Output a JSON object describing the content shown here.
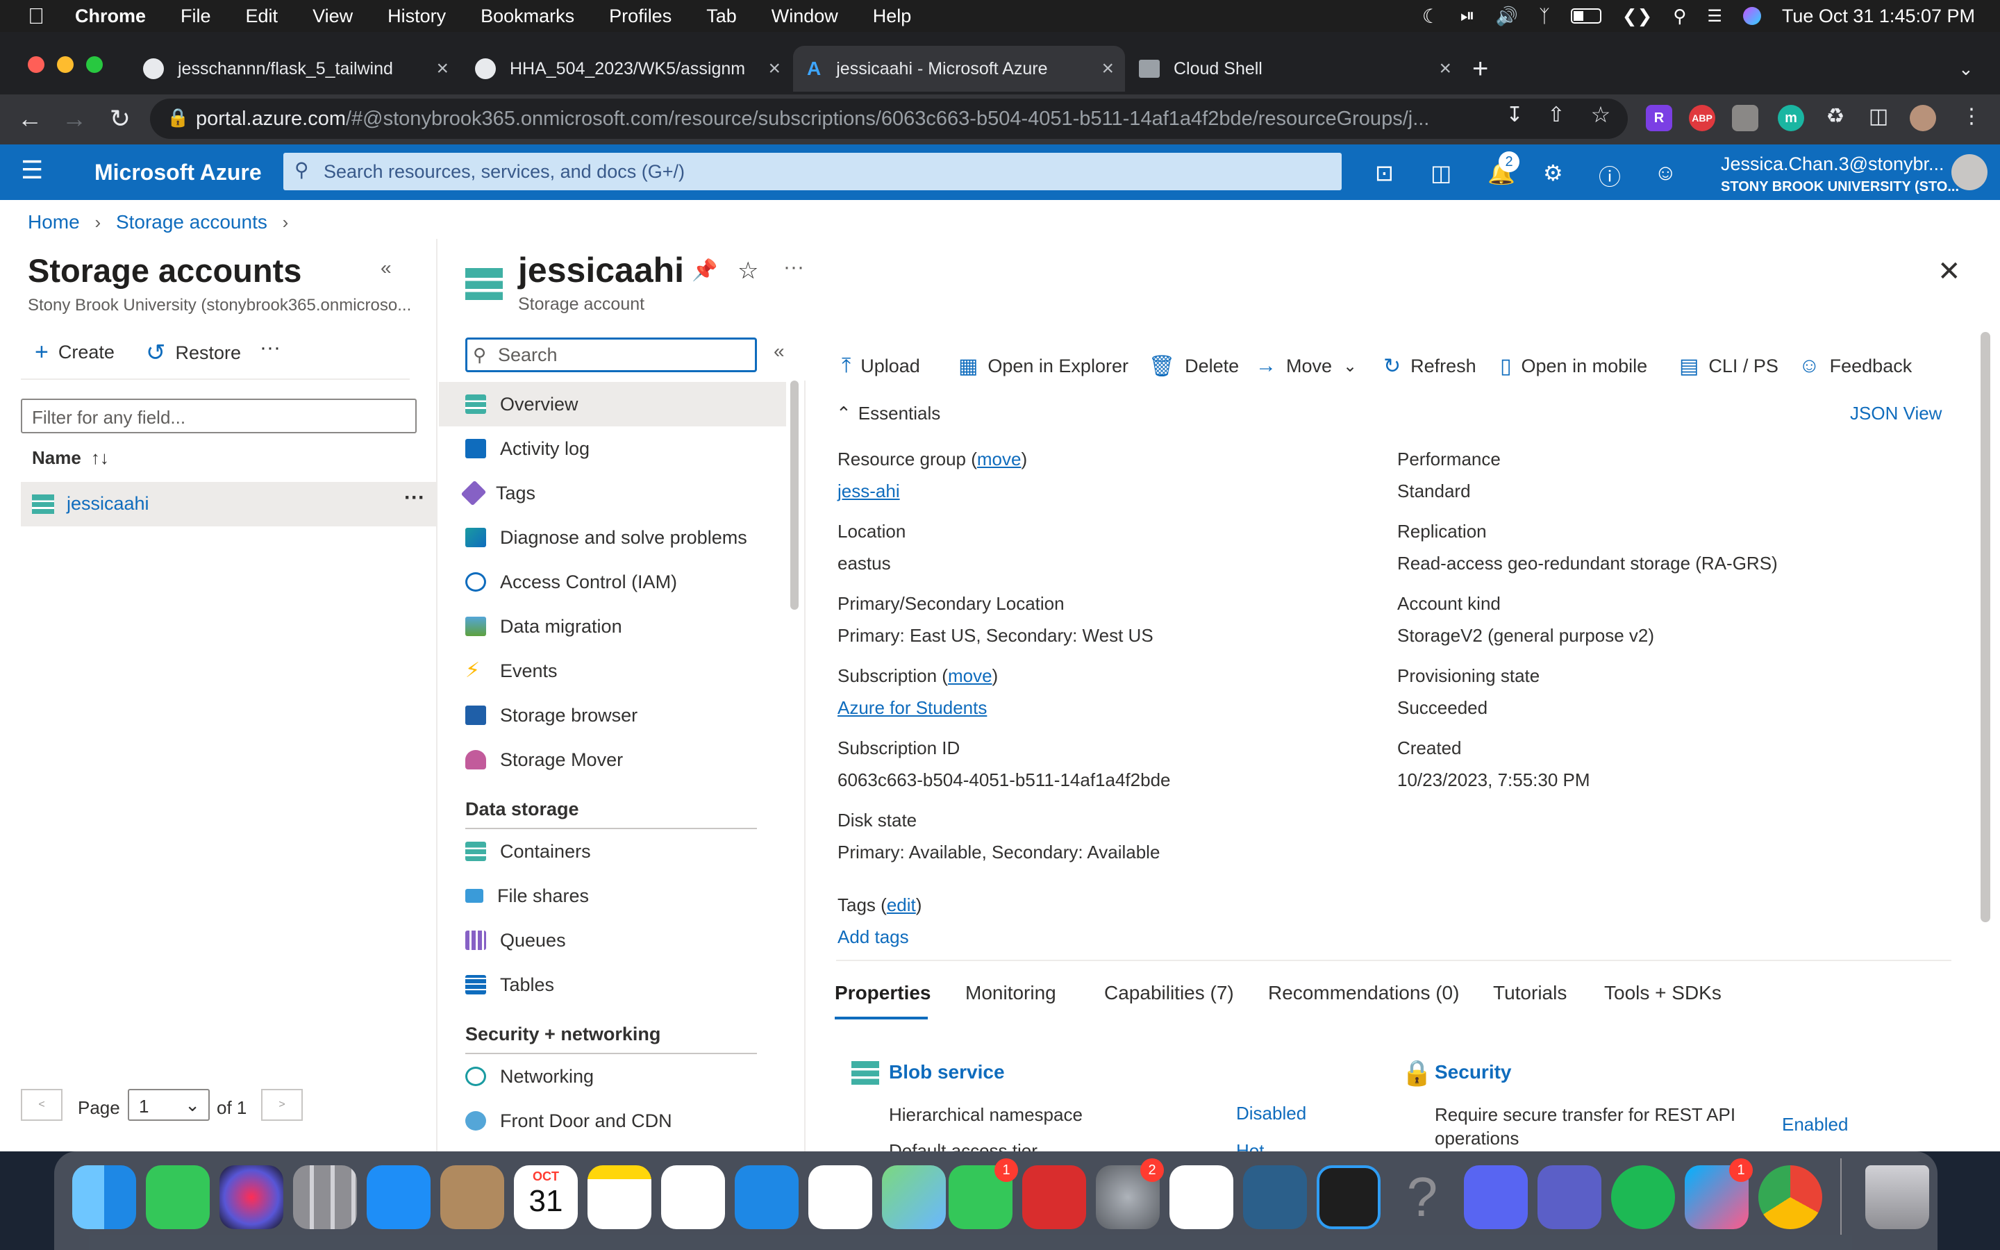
{
  "menubar": {
    "app": "Chrome",
    "items": [
      "File",
      "Edit",
      "View",
      "History",
      "Bookmarks",
      "Profiles",
      "Tab",
      "Window",
      "Help"
    ],
    "datetime": "Tue Oct 31  1:45:07 PM"
  },
  "browser": {
    "tabs": [
      {
        "title": "jesschannn/flask_5_tailwind"
      },
      {
        "title": "HHA_504_2023/WK5/assignm"
      },
      {
        "title": "jessicaahi - Microsoft Azure"
      },
      {
        "title": "Cloud Shell"
      }
    ],
    "new_tab": "+",
    "url_host": "portal.azure.com",
    "url_path": "/#@stonybrook365.onmicrosoft.com/resource/subscriptions/6063c663-b504-4051-b511-14af1a4f2bde/resourceGroups/j...",
    "extensions": [
      "R",
      "ABP",
      "",
      "m"
    ]
  },
  "azure": {
    "brand": "Microsoft Azure",
    "search_placeholder": "Search resources, services, and docs (G+/)",
    "notifications_count": "2",
    "user": "Jessica.Chan.3@stonybr...",
    "org": "STONY BROOK UNIVERSITY (STO..."
  },
  "breadcrumb": [
    "Home",
    "Storage accounts"
  ],
  "left_blade": {
    "title": "Storage accounts",
    "subtitle": "Stony Brook University (stonybrook365.onmicroso...",
    "create": "Create",
    "restore": "Restore",
    "more": "···",
    "filter_placeholder": "Filter for any field...",
    "col_name": "Name",
    "items": [
      "jessicaahi"
    ],
    "page_label": "Page",
    "page_value": "1",
    "page_of": "of 1"
  },
  "resource": {
    "name": "jessicaahi",
    "type": "Storage account",
    "menu_search_placeholder": "Search",
    "menu": [
      "Overview",
      "Activity log",
      "Tags",
      "Diagnose and solve problems",
      "Access Control (IAM)",
      "Data migration",
      "Events",
      "Storage browser",
      "Storage Mover"
    ],
    "section_data_storage": "Data storage",
    "data_storage": [
      "Containers",
      "File shares",
      "Queues",
      "Tables"
    ],
    "section_security": "Security + networking",
    "security": [
      "Networking",
      "Front Door and CDN"
    ]
  },
  "toolbar": [
    "Upload",
    "Open in Explorer",
    "Delete",
    "Move",
    "Refresh",
    "Open in mobile",
    "CLI / PS",
    "Feedback"
  ],
  "essentials": {
    "title": "Essentials",
    "json_view": "JSON View",
    "move": "move",
    "left": [
      {
        "label": "Resource group",
        "value": "jess-ahi"
      },
      {
        "label": "Location",
        "value": "eastus"
      },
      {
        "label": "Primary/Secondary Location",
        "value": "Primary: East US, Secondary: West US"
      },
      {
        "label": "Subscription",
        "value": "Azure for Students"
      },
      {
        "label": "Subscription ID",
        "value": "6063c663-b504-4051-b511-14af1a4f2bde"
      },
      {
        "label": "Disk state",
        "value": "Primary: Available, Secondary: Available"
      }
    ],
    "right": [
      {
        "label": "Performance",
        "value": "Standard"
      },
      {
        "label": "Replication",
        "value": "Read-access geo-redundant storage (RA-GRS)"
      },
      {
        "label": "Account kind",
        "value": "StorageV2 (general purpose v2)"
      },
      {
        "label": "Provisioning state",
        "value": "Succeeded"
      },
      {
        "label": "Created",
        "value": "10/23/2023, 7:55:30 PM"
      }
    ],
    "tags_label": "Tags",
    "tags_edit": "edit",
    "add_tags": "Add tags"
  },
  "tabs": [
    "Properties",
    "Monitoring",
    "Capabilities (7)",
    "Recommendations (0)",
    "Tutorials",
    "Tools + SDKs"
  ],
  "properties": {
    "blob_title": "Blob service",
    "blob_rows": [
      {
        "label": "Hierarchical namespace",
        "value": "Disabled"
      },
      {
        "label": "Default access tier",
        "value": "Hot"
      }
    ],
    "security_title": "Security",
    "security_rows": [
      {
        "label": "Require secure transfer for REST API operations",
        "value": "Enabled"
      }
    ]
  },
  "dock": {
    "calendar_month": "OCT",
    "calendar_day": "31",
    "badges": {
      "messages": "1",
      "settings": "2",
      "messenger": "1"
    }
  }
}
